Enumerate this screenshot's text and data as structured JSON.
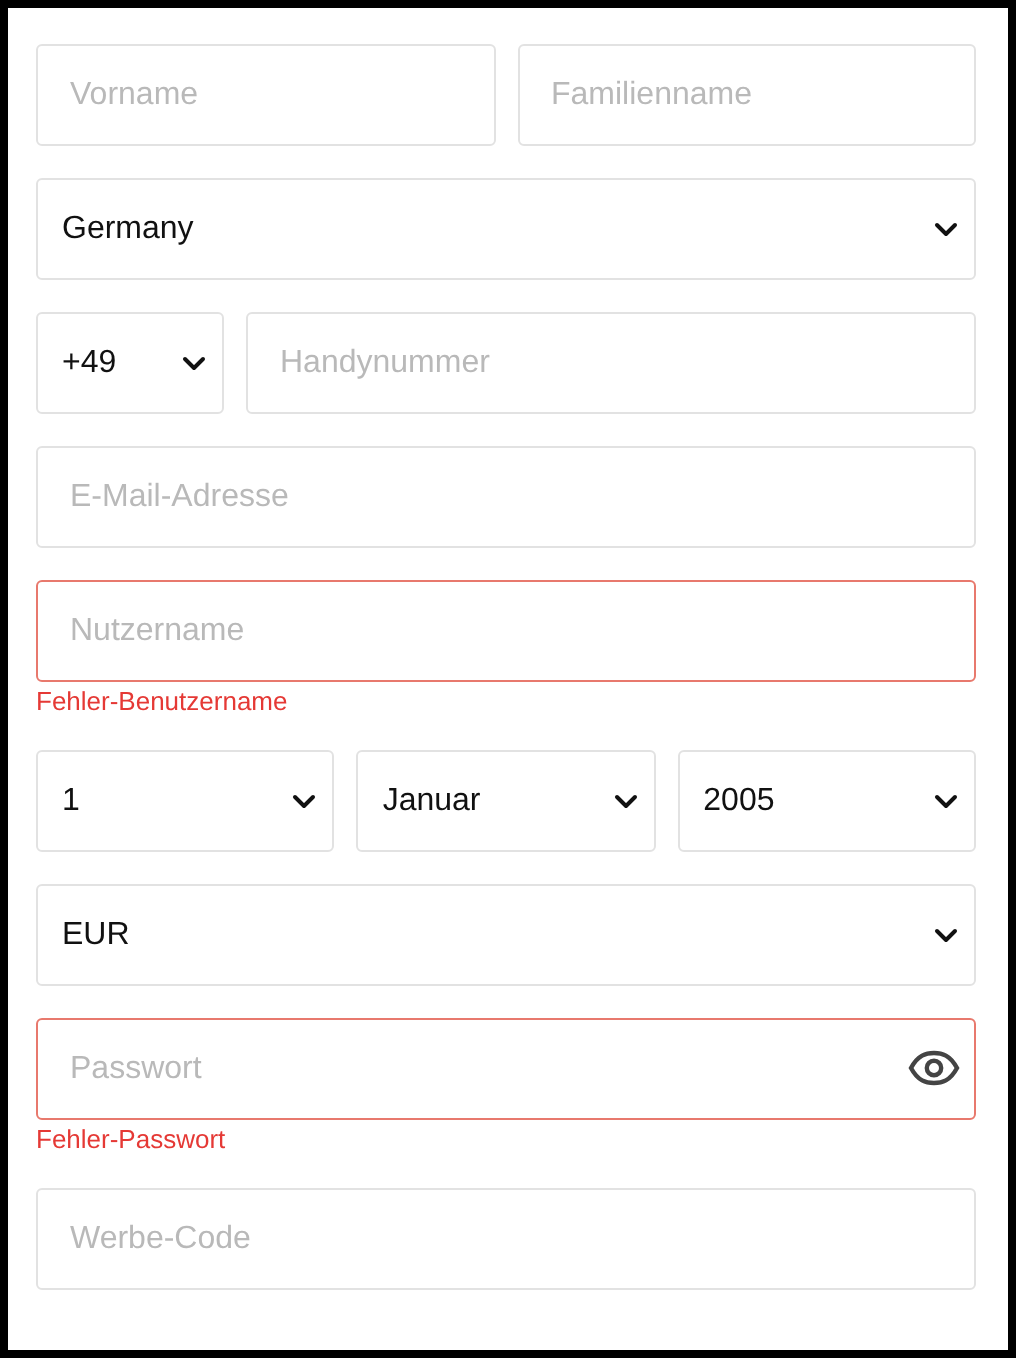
{
  "rows": [
    {
      "fields": [
        {
          "kind": "text",
          "placeholder": "Vorname",
          "invalid": false
        },
        {
          "kind": "text",
          "placeholder": "Familienname",
          "invalid": false
        }
      ]
    },
    {
      "fields": [
        {
          "kind": "select",
          "value": "Germany",
          "invalid": false
        }
      ]
    },
    {
      "fields": [
        {
          "kind": "code-select",
          "value": "+49",
          "invalid": false
        },
        {
          "kind": "text",
          "placeholder": "Handynummer",
          "invalid": false
        }
      ]
    },
    {
      "fields": [
        {
          "kind": "text",
          "placeholder": "E-Mail-Adresse",
          "invalid": false
        }
      ]
    },
    {
      "fields": [
        {
          "kind": "text",
          "placeholder": "Nutzername",
          "invalid": true
        }
      ],
      "error": "Fehler-Benutzername"
    },
    {
      "fields": [
        {
          "kind": "select",
          "value": "1",
          "invalid": false
        },
        {
          "kind": "select",
          "value": "Januar",
          "invalid": false
        },
        {
          "kind": "select",
          "value": "2005",
          "invalid": false
        }
      ]
    },
    {
      "fields": [
        {
          "kind": "select",
          "value": "EUR",
          "invalid": false
        }
      ]
    },
    {
      "fields": [
        {
          "kind": "password",
          "placeholder": "Passwort",
          "invalid": true
        }
      ],
      "error": "Fehler-Passwort"
    },
    {
      "fields": [
        {
          "kind": "text",
          "placeholder": "Werbe-Code",
          "invalid": false
        }
      ]
    }
  ]
}
